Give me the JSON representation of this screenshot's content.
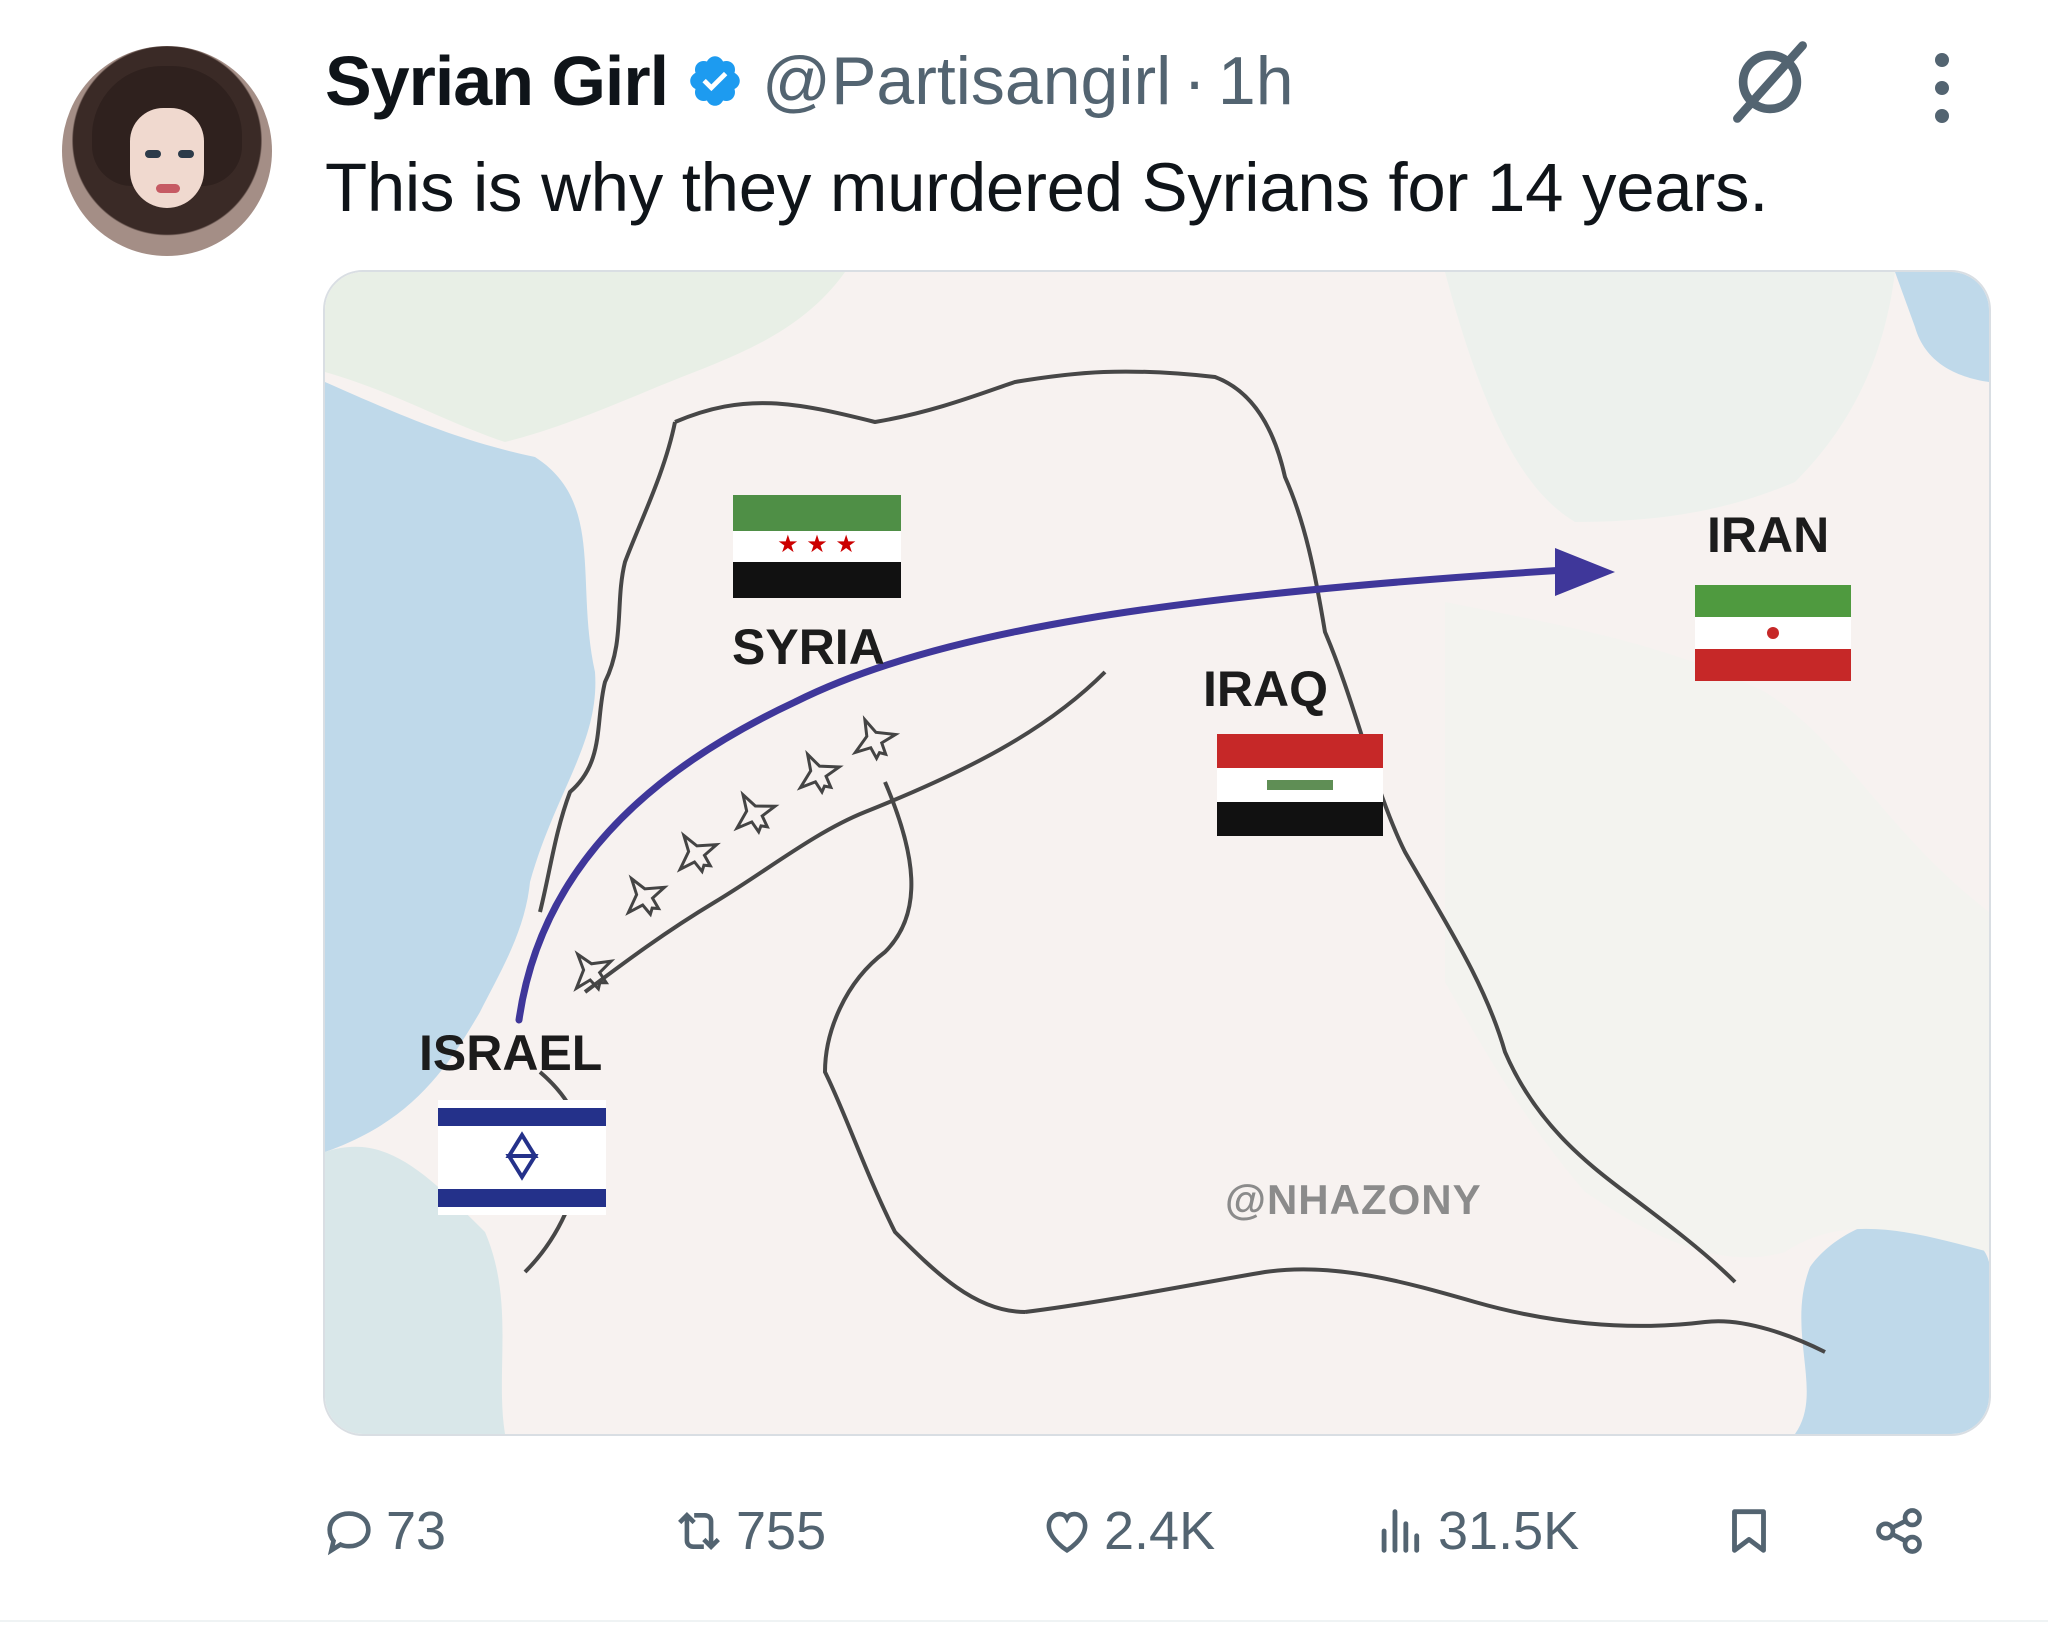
{
  "tweet": {
    "author_name": "Syrian Girl",
    "handle": "@Partisangirl",
    "separator": "·",
    "time": "1h",
    "text": "This is why they murdered Syrians for 14 years."
  },
  "media": {
    "labels": {
      "syria": "SYRIA",
      "iraq": "IRAQ",
      "iran": "IRAN",
      "israel": "ISRAEL",
      "watermark": "@NHAZONY"
    },
    "colors": {
      "arrow": "#3f379a",
      "sea": "#bfd9ea",
      "land": "#f7f2f0",
      "border": "#474747"
    }
  },
  "actions": {
    "replies": "73",
    "reposts": "755",
    "likes": "2.4K",
    "views": "31.5K"
  },
  "icons": {
    "verified": "verified-badge-icon",
    "grok": "grok-icon",
    "more": "more-icon",
    "reply": "reply-icon",
    "repost": "repost-icon",
    "like": "heart-icon",
    "views": "views-icon",
    "bookmark": "bookmark-icon",
    "share": "share-icon"
  }
}
